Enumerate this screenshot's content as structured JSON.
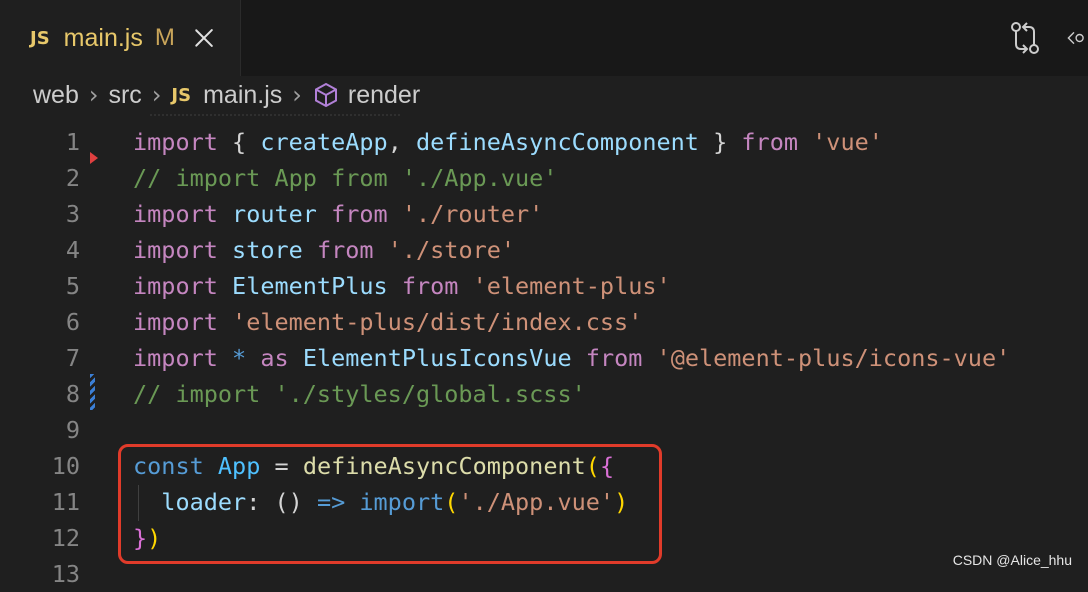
{
  "tab": {
    "badge": "JS",
    "title": "main.js",
    "modified": "M"
  },
  "breadcrumb": {
    "items": [
      "web",
      "src",
      "main.js",
      "render"
    ],
    "js_badge": "JS"
  },
  "editor": {
    "lines": [
      {
        "n": "1",
        "tokens": [
          [
            "kw",
            "import"
          ],
          [
            "op",
            " { "
          ],
          [
            "var",
            "createApp"
          ],
          [
            "op",
            ", "
          ],
          [
            "var",
            "defineAsyncComponent"
          ],
          [
            "op",
            " } "
          ],
          [
            "kw",
            "from"
          ],
          [
            "op",
            " "
          ],
          [
            "str",
            "'vue'"
          ]
        ]
      },
      {
        "n": "2",
        "tokens": [
          [
            "cm",
            "// import App from './App.vue'"
          ]
        ]
      },
      {
        "n": "3",
        "tokens": [
          [
            "kw",
            "import"
          ],
          [
            "op",
            " "
          ],
          [
            "var",
            "router"
          ],
          [
            "op",
            " "
          ],
          [
            "kw",
            "from"
          ],
          [
            "op",
            " "
          ],
          [
            "str",
            "'./router'"
          ]
        ]
      },
      {
        "n": "4",
        "tokens": [
          [
            "kw",
            "import"
          ],
          [
            "op",
            " "
          ],
          [
            "var",
            "store"
          ],
          [
            "op",
            " "
          ],
          [
            "kw",
            "from"
          ],
          [
            "op",
            " "
          ],
          [
            "str",
            "'./store'"
          ]
        ]
      },
      {
        "n": "5",
        "tokens": [
          [
            "kw",
            "import"
          ],
          [
            "op",
            " "
          ],
          [
            "var",
            "ElementPlus"
          ],
          [
            "op",
            " "
          ],
          [
            "kw",
            "from"
          ],
          [
            "op",
            " "
          ],
          [
            "str",
            "'element-plus'"
          ]
        ]
      },
      {
        "n": "6",
        "tokens": [
          [
            "kw",
            "import"
          ],
          [
            "op",
            " "
          ],
          [
            "str",
            "'element-plus/dist/index.css'"
          ]
        ]
      },
      {
        "n": "7",
        "tokens": [
          [
            "kw",
            "import"
          ],
          [
            "op",
            " "
          ],
          [
            "kwb",
            "*"
          ],
          [
            "op",
            " "
          ],
          [
            "kw",
            "as"
          ],
          [
            "op",
            " "
          ],
          [
            "var",
            "ElementPlusIconsVue"
          ],
          [
            "op",
            " "
          ],
          [
            "kw",
            "from"
          ],
          [
            "op",
            " "
          ],
          [
            "str",
            "'@element-plus/icons-vue'"
          ]
        ]
      },
      {
        "n": "8",
        "tokens": [
          [
            "cm",
            "// import './styles/global.scss'"
          ]
        ]
      },
      {
        "n": "9",
        "tokens": []
      },
      {
        "n": "10",
        "tokens": [
          [
            "kwb",
            "const"
          ],
          [
            "op",
            " "
          ],
          [
            "imp",
            "App"
          ],
          [
            "op",
            " = "
          ],
          [
            "fn",
            "defineAsyncComponent"
          ],
          [
            "brace",
            "("
          ],
          [
            "paren",
            "{"
          ]
        ]
      },
      {
        "n": "11",
        "tokens": [
          [
            "op",
            "  "
          ],
          [
            "var",
            "loader"
          ],
          [
            "op",
            ": "
          ],
          [
            "op",
            "() "
          ],
          [
            "arrow",
            "=>"
          ],
          [
            "op",
            " "
          ],
          [
            "kwb",
            "import"
          ],
          [
            "brace",
            "("
          ],
          [
            "str",
            "'./App.vue'"
          ],
          [
            "brace",
            ")"
          ]
        ]
      },
      {
        "n": "12",
        "tokens": [
          [
            "paren",
            "}"
          ],
          [
            "brace",
            ")"
          ]
        ]
      },
      {
        "n": "13",
        "tokens": []
      }
    ]
  },
  "watermark": "CSDN @Alice_hhu",
  "colors": {
    "highlight": "#e03b2a",
    "js_badge": "#e8c86a",
    "modified_gutter": "#3b7fd6",
    "deleted_marker": "#e04040"
  }
}
